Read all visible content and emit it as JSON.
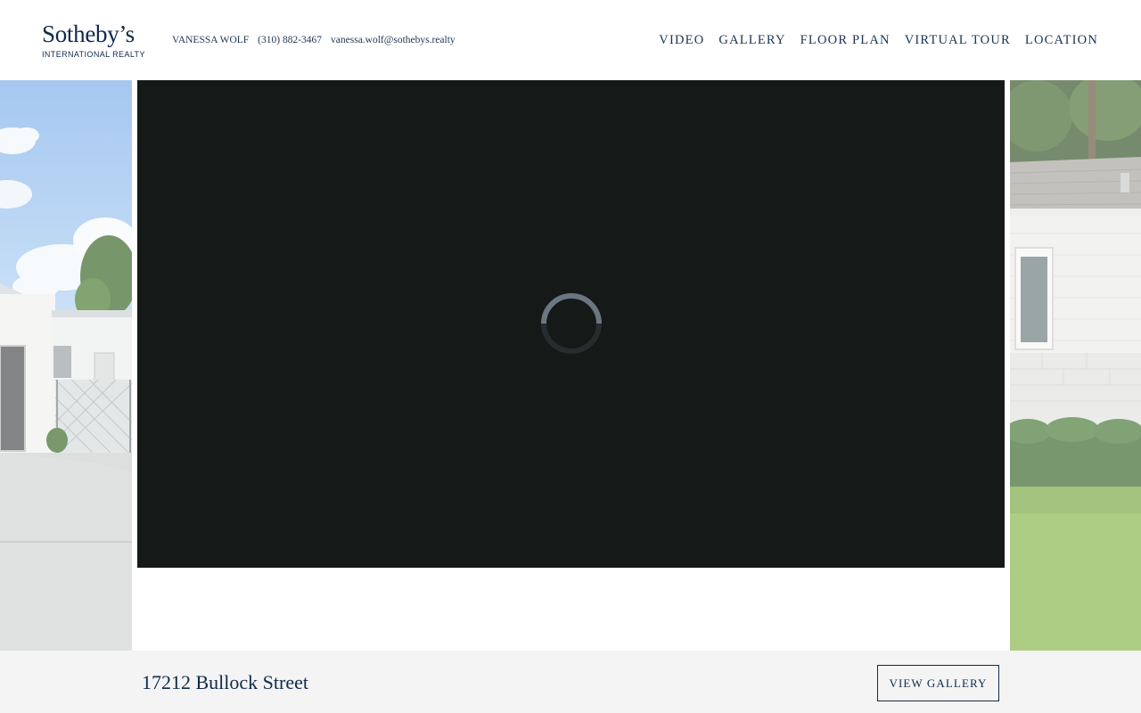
{
  "brand": {
    "name": "Sotheby’s",
    "tagline": "INTERNATIONAL REALTY"
  },
  "agent": {
    "name": "VANESSA WOLF",
    "phone": "(310) 882-3467",
    "email": "vanessa.wolf@sothebys.realty"
  },
  "nav": {
    "items": [
      {
        "label": "VIDEO"
      },
      {
        "label": "GALLERY"
      },
      {
        "label": "FLOOR PLAN"
      },
      {
        "label": "VIRTUAL TOUR"
      },
      {
        "label": "LOCATION"
      }
    ]
  },
  "hero": {
    "left_photo_icon": "house-exterior-photo",
    "right_photo_icon": "house-side-photo",
    "video_state_icon": "loading-spinner-icon"
  },
  "property": {
    "address": "17212 Bullock Street",
    "view_gallery_label": "VIEW GALLERY"
  },
  "colors": {
    "brand_navy": "#0f2a4a",
    "video_background": "#151a18",
    "footer_background": "#f4f4f4"
  }
}
